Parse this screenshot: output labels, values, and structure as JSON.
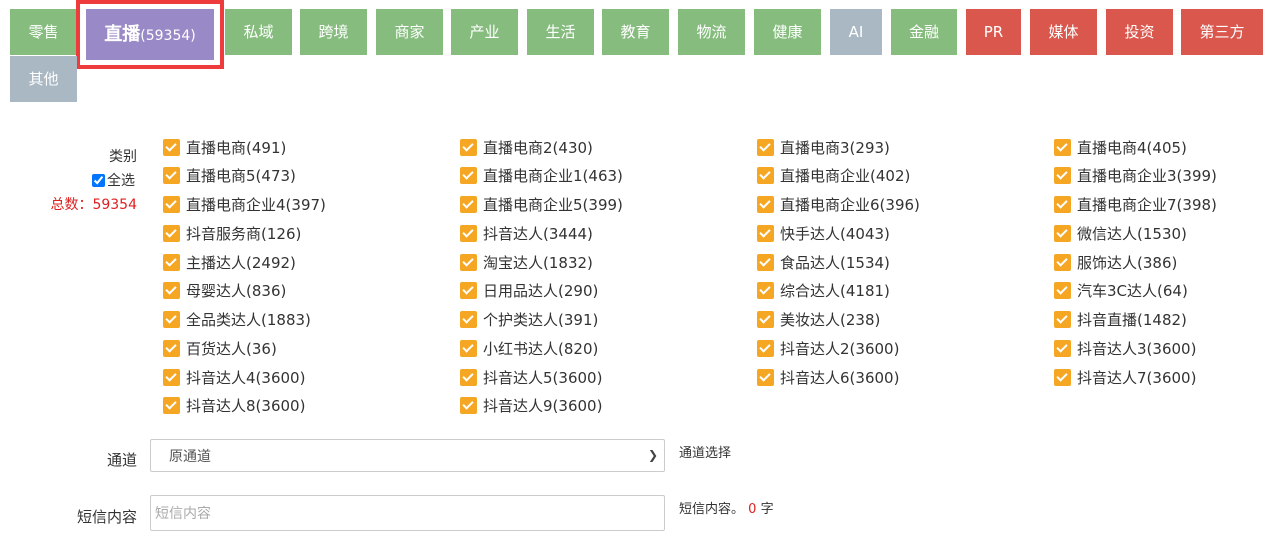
{
  "tabs": {
    "retail": "零售",
    "active_name": "直播",
    "active_count": "(59354)",
    "private": "私域",
    "crossborder": "跨境",
    "merchant": "商家",
    "industry": "产业",
    "life": "生活",
    "education": "教育",
    "logistics": "物流",
    "health": "健康",
    "ai": "AI",
    "finance": "金融",
    "pr": "PR",
    "media": "媒体",
    "invest": "投资",
    "thirdparty": "第三方",
    "other": "其他"
  },
  "colors": {
    "tab_green": "#86bd7f",
    "tab_gray": "#a9b8c3",
    "tab_red": "#d9574c",
    "tab_active": "#9a89c7",
    "active_border": "#ee3b3b",
    "checkbox": "#f5a623",
    "total_red": "#e02020"
  },
  "filter": {
    "category_label": "类别",
    "select_all_label": "全选",
    "total_text": "总数：59354"
  },
  "categories": [
    "直播电商(491)",
    "直播电商2(430)",
    "直播电商3(293)",
    "直播电商4(405)",
    "直播电商5(473)",
    "直播电商企业1(463)",
    "直播电商企业(402)",
    "直播电商企业3(399)",
    "直播电商企业4(397)",
    "直播电商企业5(399)",
    "直播电商企业6(396)",
    "直播电商企业7(398)",
    "抖音服务商(126)",
    "抖音达人(3444)",
    "快手达人(4043)",
    "微信达人(1530)",
    "主播达人(2492)",
    "淘宝达人(1832)",
    "食品达人(1534)",
    "服饰达人(386)",
    "母婴达人(836)",
    "日用品达人(290)",
    "综合达人(4181)",
    "汽车3C达人(64)",
    "全品类达人(1883)",
    "个护类达人(391)",
    "美妆达人(238)",
    "抖音直播(1482)",
    "百货达人(36)",
    "小红书达人(820)",
    "抖音达人2(3600)",
    "抖音达人3(3600)",
    "抖音达人4(3600)",
    "抖音达人5(3600)",
    "抖音达人6(3600)",
    "抖音达人7(3600)",
    "抖音达人8(3600)",
    "抖音达人9(3600)"
  ],
  "form": {
    "channel_label": "通道",
    "channel_value": "原通道",
    "channel_hint": "通道选择",
    "sms_label": "短信内容",
    "sms_placeholder": "短信内容",
    "sms_hint_prefix": "短信内容。",
    "sms_count": "0",
    "sms_hint_suffix": "字"
  }
}
